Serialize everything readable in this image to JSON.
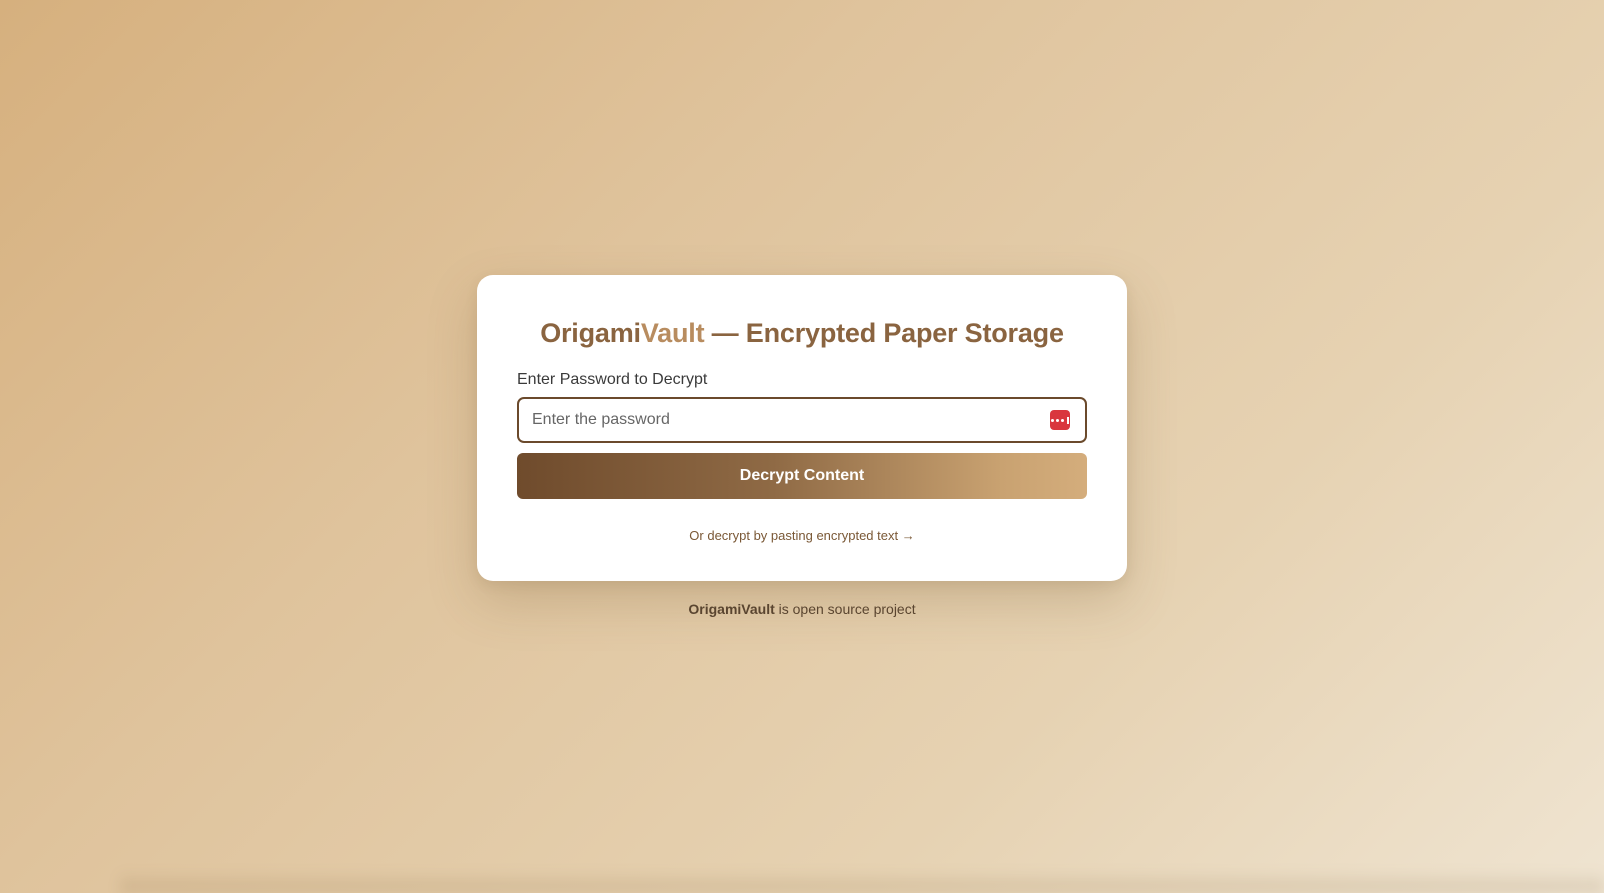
{
  "header": {
    "brand_part1": "Origami",
    "brand_part2": "Vault",
    "title_suffix": " — Encrypted Paper Storage"
  },
  "form": {
    "password_label": "Enter Password to Decrypt",
    "password_placeholder": "Enter the password",
    "password_value": "",
    "password_manager_icon": "password-manager-icon",
    "submit_label": "Decrypt Content",
    "alt_link_label": "Or decrypt by pasting encrypted text →"
  },
  "footer": {
    "brand": "OrigamiVault",
    "text": " is open source project"
  },
  "colors": {
    "accent": "#8a6440",
    "accent_light": "#b88c5f",
    "input_border": "#6b4a2c",
    "password_icon": "#d9363e"
  }
}
